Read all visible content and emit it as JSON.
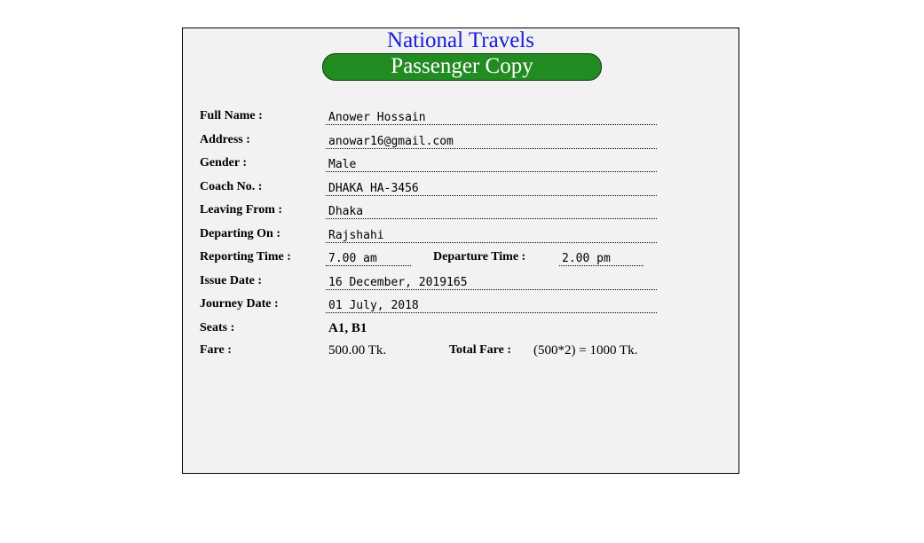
{
  "header": {
    "company": "National Travels",
    "copy_type": "Passenger Copy"
  },
  "fields": {
    "full_name": {
      "label": "Full Name :",
      "value": "Anower Hossain"
    },
    "address": {
      "label": "Address :",
      "value": "anowar16@gmail.com"
    },
    "gender": {
      "label": "Gender :",
      "value": "Male"
    },
    "coach_no": {
      "label": "Coach No. :",
      "value": "DHAKA HA-3456"
    },
    "leaving_from": {
      "label": "Leaving From :",
      "value": "Dhaka"
    },
    "departing_on": {
      "label": "Departing On :",
      "value": "Rajshahi"
    },
    "reporting_time": {
      "label": "Reporting Time :",
      "value": "7.00 am"
    },
    "departure_time": {
      "label": "Departure Time :",
      "value": "2.00 pm"
    },
    "issue_date": {
      "label": "Issue Date :",
      "value": "16 December, 2019165"
    },
    "journey_date": {
      "label": "Journey Date :",
      "value": "01 July, 2018"
    },
    "seats": {
      "label": "Seats :",
      "value": "A1, B1"
    },
    "fare": {
      "label": "Fare :",
      "value": "500.00 Tk."
    },
    "total_fare": {
      "label": "Total Fare :",
      "value": "(500*2) = 1000 Tk."
    }
  }
}
